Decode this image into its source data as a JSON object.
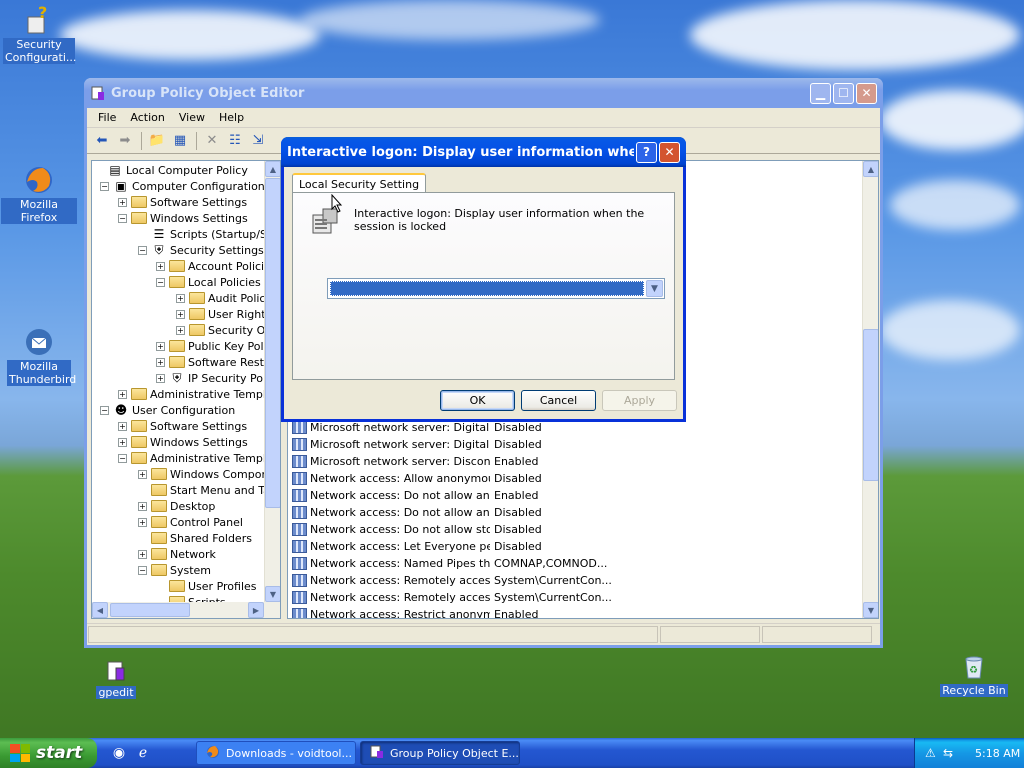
{
  "desktop": {
    "icons": [
      {
        "label": "Security Configurati...",
        "icon": "security-config-icon"
      },
      {
        "label": "Mozilla Firefox",
        "icon": "firefox-icon"
      },
      {
        "label": "Mozilla Thunderbird",
        "icon": "thunderbird-icon"
      },
      {
        "label": "gpedit",
        "icon": "gpedit-icon"
      },
      {
        "label": "Recycle Bin",
        "icon": "recycle-bin-icon"
      }
    ]
  },
  "main_window": {
    "title": "Group Policy Object Editor",
    "menu": [
      "File",
      "Action",
      "View",
      "Help"
    ],
    "tree": [
      {
        "label": "Local Computer Policy",
        "expander": ""
      },
      {
        "label": "Computer Configuration",
        "expander": "−"
      },
      {
        "label": "Software Settings",
        "expander": "+"
      },
      {
        "label": "Windows Settings",
        "expander": "−"
      },
      {
        "label": "Scripts (Startup/Shutdown)",
        "expander": ""
      },
      {
        "label": "Security Settings",
        "expander": "−"
      },
      {
        "label": "Account Policies",
        "expander": "+"
      },
      {
        "label": "Local Policies",
        "expander": "−"
      },
      {
        "label": "Audit Policy",
        "expander": "+"
      },
      {
        "label": "User Rights",
        "expander": "+"
      },
      {
        "label": "Security Options",
        "expander": "+"
      },
      {
        "label": "Public Key Policies",
        "expander": "+"
      },
      {
        "label": "Software Restriction Policies",
        "expander": "+"
      },
      {
        "label": "IP Security Policies",
        "expander": "+"
      },
      {
        "label": "Administrative Templates",
        "expander": "+"
      },
      {
        "label": "User Configuration",
        "expander": "−"
      },
      {
        "label": "Software Settings",
        "expander": "+"
      },
      {
        "label": "Windows Settings",
        "expander": "+"
      },
      {
        "label": "Administrative Templates",
        "expander": "−"
      },
      {
        "label": "Windows Components",
        "expander": "+"
      },
      {
        "label": "Start Menu and Taskbar",
        "expander": ""
      },
      {
        "label": "Desktop",
        "expander": "+"
      },
      {
        "label": "Control Panel",
        "expander": "+"
      },
      {
        "label": "Shared Folders",
        "expander": ""
      },
      {
        "label": "Network",
        "expander": "+"
      },
      {
        "label": "System",
        "expander": "−"
      },
      {
        "label": "User Profiles",
        "expander": ""
      },
      {
        "label": "Scripts",
        "expander": ""
      }
    ],
    "policies": [
      {
        "name": "Microsoft network server: Digitally...",
        "setting": "Disabled"
      },
      {
        "name": "Microsoft network server: Digitally...",
        "setting": "Disabled"
      },
      {
        "name": "Microsoft network server: Disconn...",
        "setting": "Enabled"
      },
      {
        "name": "Network access: Allow anonymou...",
        "setting": "Disabled"
      },
      {
        "name": "Network access: Do not allow ano...",
        "setting": "Enabled"
      },
      {
        "name": "Network access: Do not allow ano...",
        "setting": "Disabled"
      },
      {
        "name": "Network access: Do not allow stor...",
        "setting": "Disabled"
      },
      {
        "name": "Network access: Let Everyone pe...",
        "setting": "Disabled"
      },
      {
        "name": "Network access: Named Pipes tha...",
        "setting": "COMNAP,COMNOD..."
      },
      {
        "name": "Network access: Remotely accessi...",
        "setting": "System\\CurrentCon..."
      },
      {
        "name": "Network access: Remotely accessi...",
        "setting": "System\\CurrentCon..."
      },
      {
        "name": "Network access: Restrict anonym...",
        "setting": "Enabled"
      }
    ]
  },
  "dialog": {
    "title": "Interactive logon: Display user information when the ...",
    "tab": "Local Security Setting",
    "policy_description": "Interactive logon: Display user information when the session is locked",
    "dropdown_value": "",
    "buttons": {
      "ok": "OK",
      "cancel": "Cancel",
      "apply": "Apply"
    }
  },
  "taskbar": {
    "start_label": "start",
    "tasks": [
      {
        "label": "Downloads - voidtool...",
        "icon": "firefox-icon"
      },
      {
        "label": "Group Policy Object E...",
        "icon": "gpedit-icon"
      }
    ],
    "clock": "5:18 AM"
  },
  "colors": {
    "title_active": "#0450e6",
    "title_inactive": "#7b9ee9",
    "selection": "#316ac5",
    "taskbar": "#245edb",
    "start_green": "#3a9a32"
  }
}
